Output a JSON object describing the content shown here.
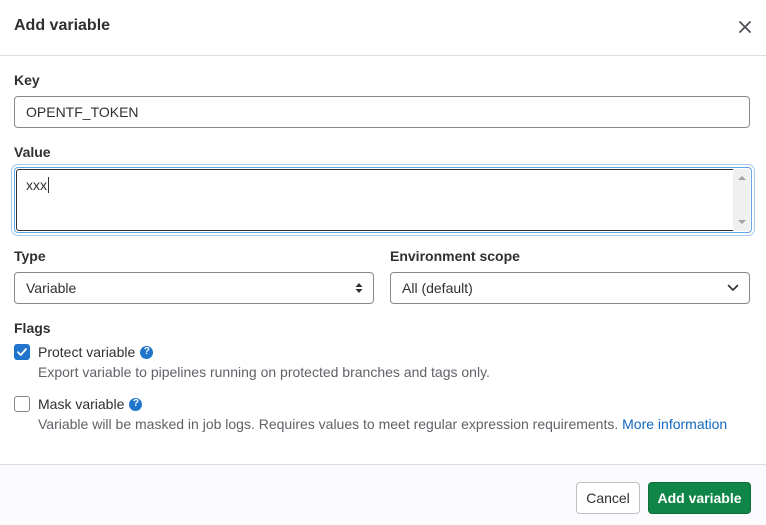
{
  "modal": {
    "title": "Add variable"
  },
  "form": {
    "key": {
      "label": "Key",
      "value": "OPENTF_TOKEN"
    },
    "value": {
      "label": "Value",
      "value": "xxx"
    },
    "type": {
      "label": "Type",
      "selected": "Variable"
    },
    "environment_scope": {
      "label": "Environment scope",
      "selected": "All (default)"
    }
  },
  "flags": {
    "label": "Flags",
    "protect": {
      "label": "Protect variable",
      "checked": true,
      "help": "Export variable to pipelines running on protected branches and tags only."
    },
    "mask": {
      "label": "Mask variable",
      "checked": false,
      "help": "Variable will be masked in job logs. Requires values to meet regular expression requirements.",
      "link": "More information"
    }
  },
  "footer": {
    "cancel_label": "Cancel",
    "submit_label": "Add variable"
  },
  "colors": {
    "primary_button": "#108548",
    "checkbox_checked": "#1f75cb",
    "link": "#1068bf",
    "focus_border": "#63a6e9"
  },
  "icons": [
    "close-icon",
    "select-updown-icon",
    "chevron-down-icon",
    "checkmark-icon",
    "question-icon"
  ]
}
